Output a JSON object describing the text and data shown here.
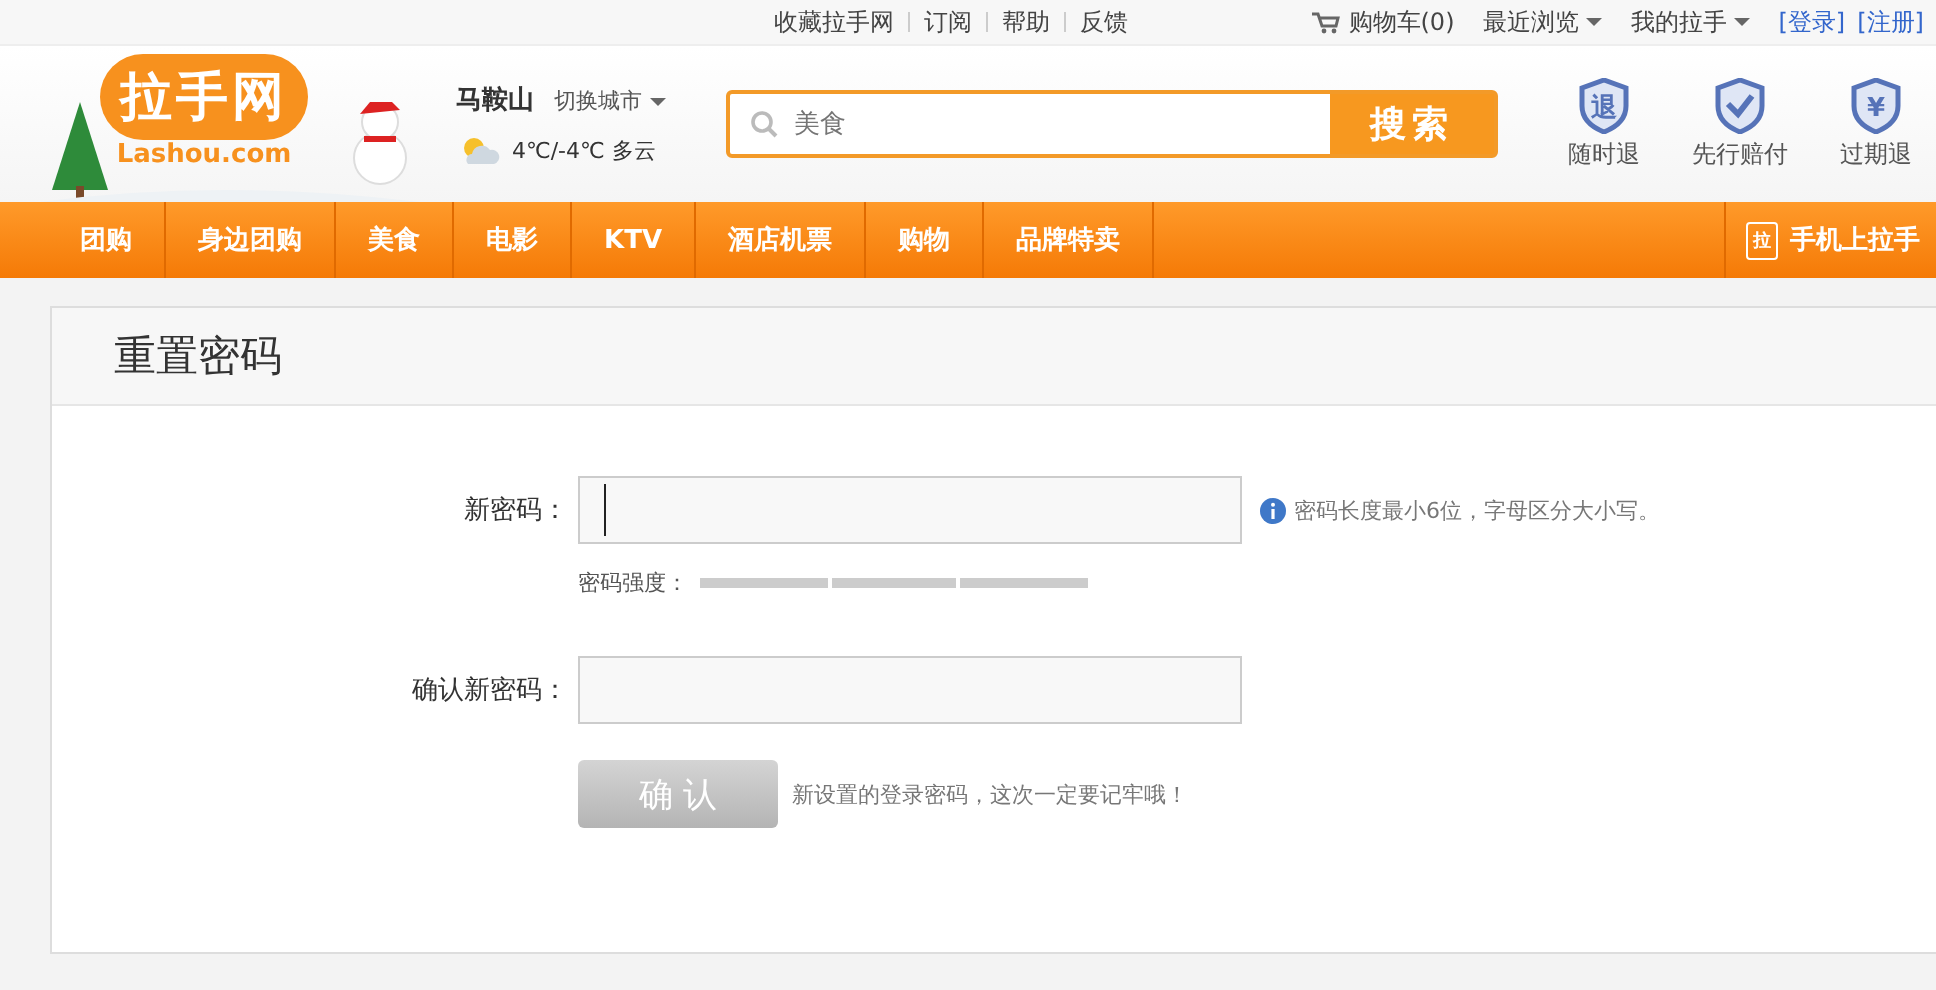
{
  "top_links": [
    "收藏拉手网",
    "订阅",
    "帮助",
    "反馈"
  ],
  "top_right": {
    "cart": "购物车(0)",
    "menus": [
      "最近浏览",
      "我的拉手"
    ],
    "auth": [
      "[登录]",
      "[注册]"
    ]
  },
  "logo": {
    "name": "拉手网",
    "domain": "Lashou.com"
  },
  "city": {
    "name": "马鞍山",
    "switch": "切换城市",
    "weather": "4℃/-4℃ 多云"
  },
  "search": {
    "placeholder": "美食",
    "button": "搜索"
  },
  "guarantees": [
    {
      "kind": "glyph",
      "glyph": "退",
      "label": "随时退"
    },
    {
      "kind": "check",
      "label": "先行赔付"
    },
    {
      "kind": "glyph",
      "glyph": "¥",
      "label": "过期退"
    }
  ],
  "nav": {
    "items": [
      "团购",
      "身边团购",
      "美食",
      "电影",
      "KTV",
      "酒店机票",
      "购物",
      "品牌特卖"
    ],
    "mobile": {
      "icon_text": "拉",
      "label": "手机上拉手"
    }
  },
  "form": {
    "title": "重置密码",
    "new_password": {
      "label": "新密码：",
      "hint": "密码长度最小6位，字母区分大小写。"
    },
    "strength": {
      "label": "密码强度：",
      "level": 0
    },
    "confirm_password": {
      "label": "确认新密码："
    },
    "submit": {
      "label": "确 认",
      "disabled": true,
      "note": "新设置的登录密码，这次一定要记牢哦！"
    }
  }
}
